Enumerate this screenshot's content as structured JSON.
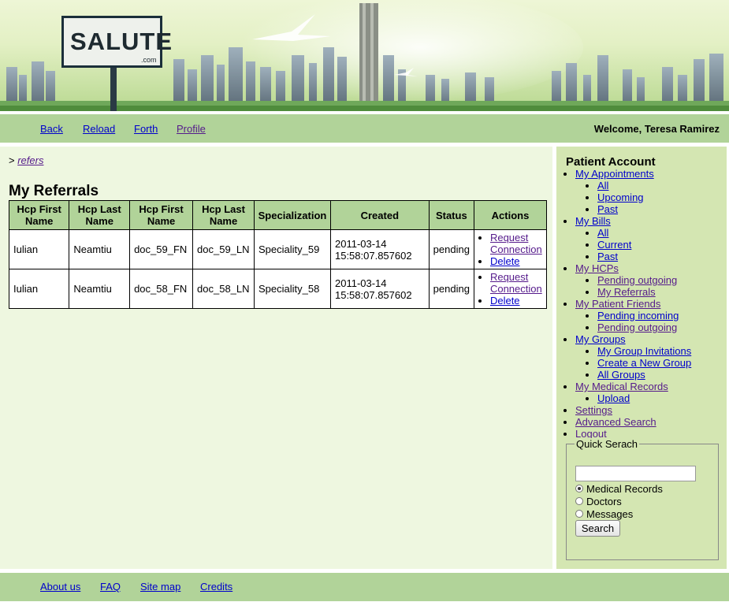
{
  "banner": {
    "logo_text": "SALUTE",
    "logo_sub": ".com"
  },
  "nav": {
    "back": "Back",
    "reload": "Reload",
    "forth": "Forth",
    "profile": "Profile",
    "welcome": "Welcome, Teresa Ramirez"
  },
  "breadcrumb": {
    "prefix": ">",
    "link": "refers"
  },
  "page": {
    "title": "My Referrals"
  },
  "table": {
    "headers": [
      "Hcp First Name",
      "Hcp Last Name",
      "Hcp First Name",
      "Hcp Last Name",
      "Specialization",
      "Created",
      "Status",
      "Actions"
    ],
    "rows": [
      {
        "c0": "Iulian",
        "c1": "Neamtiu",
        "c2": "doc_59_FN",
        "c3": "doc_59_LN",
        "c4": "Speciality_59",
        "c5": "2011-03-14 15:58:07.857602",
        "c6": "pending",
        "a1": "Request Connection",
        "a2": "Delete"
      },
      {
        "c0": "Iulian",
        "c1": "Neamtiu",
        "c2": "doc_58_FN",
        "c3": "doc_58_LN",
        "c4": "Speciality_58",
        "c5": "2011-03-14 15:58:07.857602",
        "c6": "pending",
        "a1": "Request Connection",
        "a2": "Delete"
      }
    ]
  },
  "sidebar": {
    "heading": "Patient Account",
    "appointments": {
      "label": "My Appointments",
      "all": "All",
      "upcoming": "Upcoming",
      "past": "Past"
    },
    "bills": {
      "label": "My Bills",
      "all": "All",
      "current": "Current",
      "past": "Past"
    },
    "hcps": {
      "label": "My HCPs",
      "pending_outgoing": "Pending outgoing",
      "my_referrals": "My Referrals"
    },
    "friends": {
      "label": "My Patient Friends",
      "pending_incoming": "Pending incoming",
      "pending_outgoing": "Pending outgoing"
    },
    "groups": {
      "label": "My Groups",
      "invitations": "My Group Invitations",
      "create": "Create a New Group",
      "all": "All Groups"
    },
    "records": {
      "label": "My Medical Records",
      "upload": "Upload"
    },
    "settings": "Settings",
    "advanced_search": "Advanced Search",
    "logout": "Logout"
  },
  "quick_search": {
    "legend": "Quick Serach",
    "input_value": "",
    "options": [
      "Medical Records",
      "Doctors",
      "Messages"
    ],
    "selected": "Medical Records",
    "button": "Search"
  },
  "footer": {
    "about": "About us",
    "faq": "FAQ",
    "sitemap": "Site map",
    "credits": "Credits"
  },
  "colors": {
    "nav_green": "#b1d399",
    "content_bg": "#eef7e0",
    "sidebar_bg": "#d4e6b2",
    "link": "#0000cc",
    "visited": "#551a8b"
  }
}
